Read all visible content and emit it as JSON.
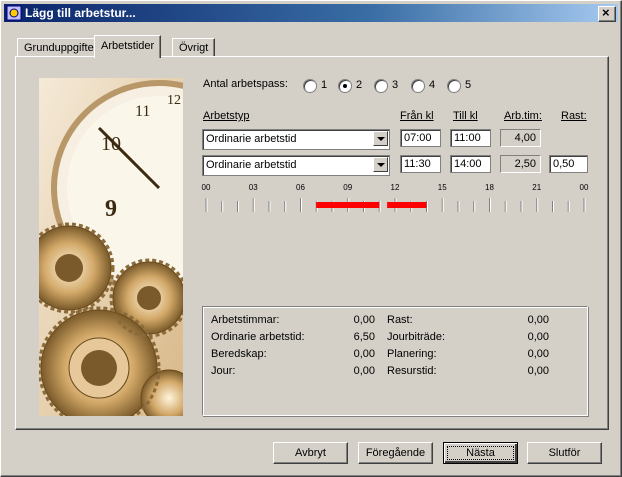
{
  "window": {
    "title": "Lägg till arbetstur..."
  },
  "tabs": [
    {
      "label": "Grunduppgifter"
    },
    {
      "label": "Arbetstider"
    },
    {
      "label": "Övrigt"
    }
  ],
  "shifts": {
    "count_label": "Antal arbetspass:",
    "options": [
      "1",
      "2",
      "3",
      "4",
      "5"
    ],
    "selected": "2"
  },
  "table": {
    "headers": {
      "type": "Arbetstyp",
      "from": "Från kl",
      "to": "Till kl",
      "hours": "Arb.tim:",
      "break": "Rast:"
    },
    "rows": [
      {
        "type": "Ordinarie arbetstid",
        "from": "07:00",
        "to": "11:00",
        "hours": "4,00",
        "break": ""
      },
      {
        "type": "Ordinarie arbetstid",
        "from": "11:30",
        "to": "14:00",
        "hours": "2,50",
        "break": "0,50"
      }
    ]
  },
  "timeline": {
    "tick_labels": [
      "00",
      "03",
      "06",
      "09",
      "12",
      "15",
      "18",
      "21",
      "00"
    ],
    "segments": [
      {
        "start_hour": 7.0,
        "end_hour": 11.0
      },
      {
        "start_hour": 11.5,
        "end_hour": 14.0
      }
    ],
    "color": "#ff0000"
  },
  "summary": {
    "left": [
      {
        "label": "Arbetstimmar:",
        "value": "0,00"
      },
      {
        "label": "Ordinarie arbetstid:",
        "value": "6,50"
      },
      {
        "label": "Beredskap:",
        "value": "0,00"
      },
      {
        "label": "Jour:",
        "value": "0,00"
      }
    ],
    "right": [
      {
        "label": "Rast:",
        "value": "0,00"
      },
      {
        "label": "Jourbiträde:",
        "value": "0,00"
      },
      {
        "label": "Planering:",
        "value": "0,00"
      },
      {
        "label": "Resurstid:",
        "value": "0,00"
      }
    ]
  },
  "buttons": {
    "cancel": "Avbryt",
    "previous": "Föregående",
    "next": "Nästa",
    "finish": "Slutför"
  },
  "image": {
    "icon": "clock-and-gears-image"
  }
}
